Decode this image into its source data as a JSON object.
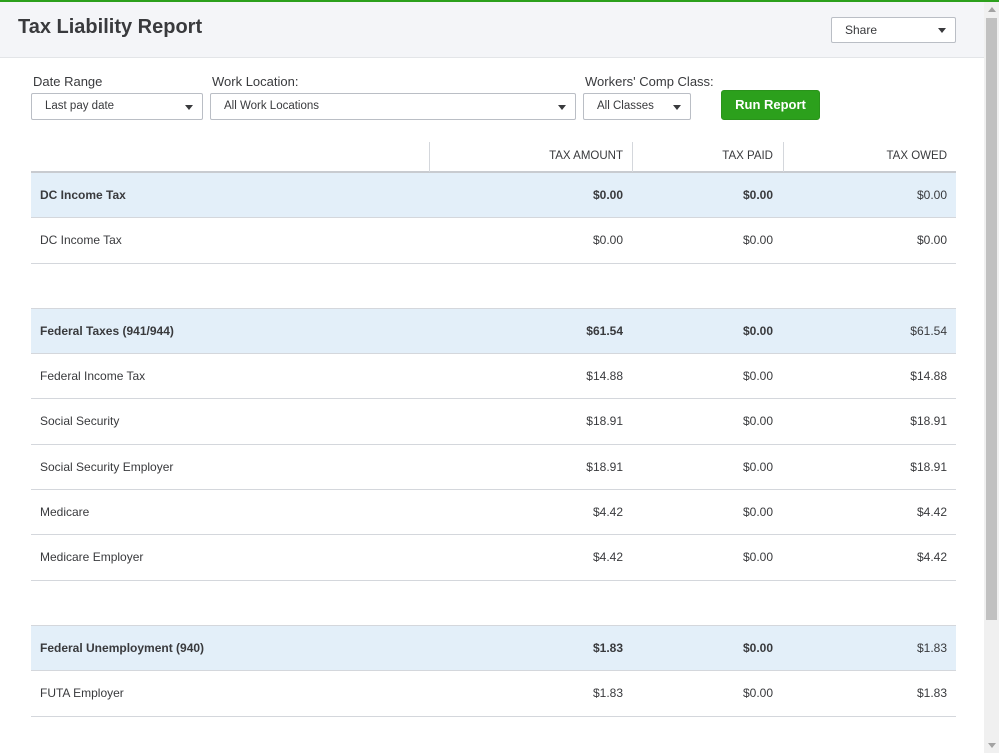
{
  "header": {
    "title": "Tax Liability Report",
    "share_label": "Share"
  },
  "filters": {
    "date_range": {
      "label": "Date Range",
      "value": "Last pay date"
    },
    "work_location": {
      "label": "Work Location:",
      "value": "All Work Locations"
    },
    "workers_comp": {
      "label": "Workers' Comp Class:",
      "value": "All Classes"
    },
    "run_label": "Run Report"
  },
  "table": {
    "columns": [
      "TAX AMOUNT",
      "TAX PAID",
      "TAX OWED"
    ],
    "rows": [
      {
        "type": "group",
        "name": "DC Income Tax",
        "tax_amount": "$0.00",
        "tax_paid": "$0.00",
        "tax_owed": "$0.00"
      },
      {
        "type": "item",
        "name": "DC Income Tax",
        "tax_amount": "$0.00",
        "tax_paid": "$0.00",
        "tax_owed": "$0.00"
      },
      {
        "type": "spacer"
      },
      {
        "type": "group",
        "name": "Federal Taxes (941/944)",
        "tax_amount": "$61.54",
        "tax_paid": "$0.00",
        "tax_owed": "$61.54"
      },
      {
        "type": "item",
        "name": "Federal Income Tax",
        "tax_amount": "$14.88",
        "tax_paid": "$0.00",
        "tax_owed": "$14.88"
      },
      {
        "type": "item",
        "name": "Social Security",
        "tax_amount": "$18.91",
        "tax_paid": "$0.00",
        "tax_owed": "$18.91"
      },
      {
        "type": "item",
        "name": "Social Security Employer",
        "tax_amount": "$18.91",
        "tax_paid": "$0.00",
        "tax_owed": "$18.91"
      },
      {
        "type": "item",
        "name": "Medicare",
        "tax_amount": "$4.42",
        "tax_paid": "$0.00",
        "tax_owed": "$4.42"
      },
      {
        "type": "item",
        "name": "Medicare Employer",
        "tax_amount": "$4.42",
        "tax_paid": "$0.00",
        "tax_owed": "$4.42"
      },
      {
        "type": "spacer"
      },
      {
        "type": "group",
        "name": "Federal Unemployment (940)",
        "tax_amount": "$1.83",
        "tax_paid": "$0.00",
        "tax_owed": "$1.83"
      },
      {
        "type": "item",
        "name": "FUTA Employer",
        "tax_amount": "$1.83",
        "tax_paid": "$0.00",
        "tax_owed": "$1.83"
      }
    ]
  },
  "colors": {
    "accent": "#2ca01c",
    "group_row_bg": "#e3eff9",
    "header_bg": "#f4f5f8"
  }
}
